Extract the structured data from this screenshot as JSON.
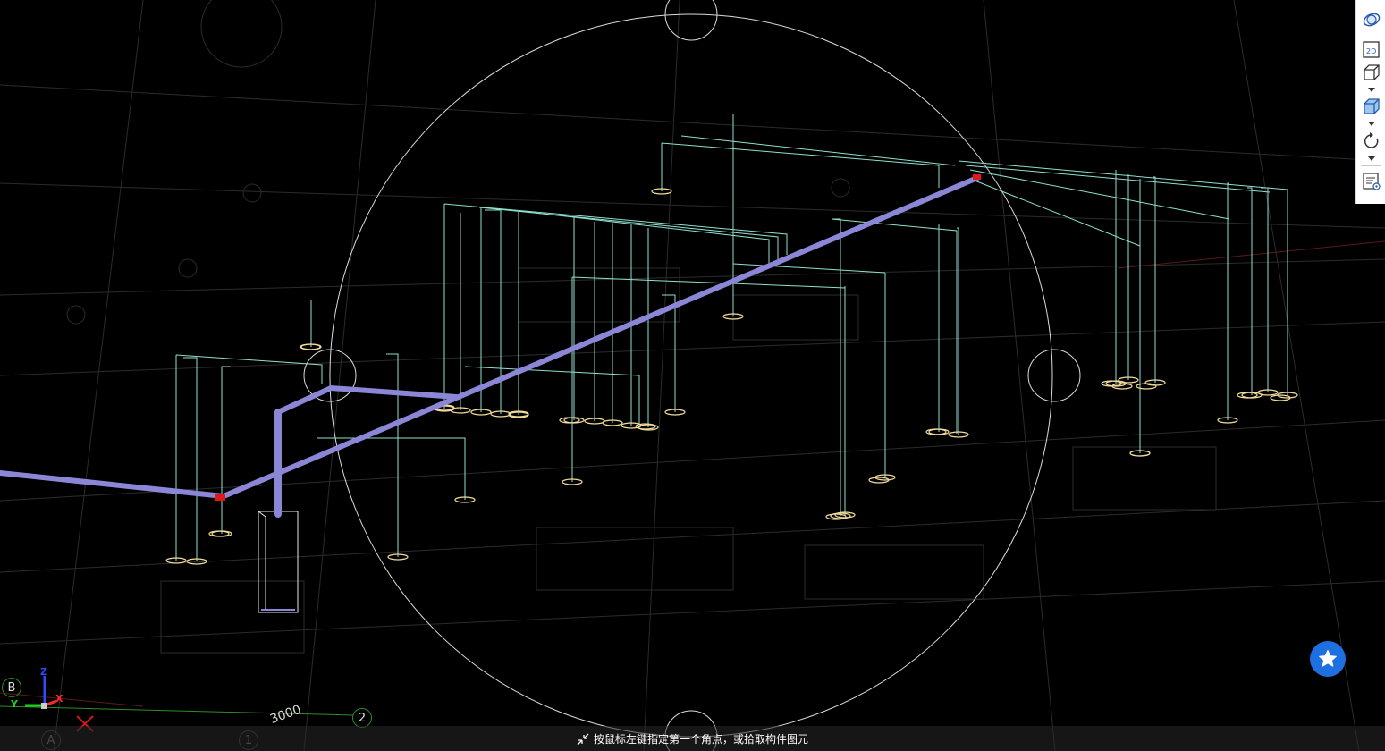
{
  "toolbar": {
    "buttons": [
      {
        "name": "orbit-icon",
        "label": ""
      },
      {
        "name": "2d-view-icon",
        "label": "2D"
      },
      {
        "name": "3d-box-icon",
        "label": ""
      },
      {
        "name": "3d-box-filled-icon",
        "label": ""
      },
      {
        "name": "rotate-icon",
        "label": ""
      },
      {
        "name": "properties-icon",
        "label": ""
      }
    ]
  },
  "status_bar": {
    "prompt": "按鼠标左键指定第一个角点，或拾取构件图元",
    "icon": "select-cursor-icon"
  },
  "axis_gizmo": {
    "z_label": "Z",
    "y_label": "Y",
    "x_label": "X"
  },
  "grid": {
    "bubble_a": "A",
    "bubble_b": "B",
    "bubble_1": "1",
    "bubble_2": "2",
    "dimension": "3000"
  },
  "fab": {
    "icon": "star-icon"
  },
  "colors": {
    "background": "#000000",
    "pipe": "#8c86d6",
    "branch_lines": "#8fe0cf",
    "sprinkler": "#f2dc9c",
    "orbit_circle": "#dcdcdc",
    "accent": "#1e6fe0",
    "pipe_end": "#e01818"
  }
}
